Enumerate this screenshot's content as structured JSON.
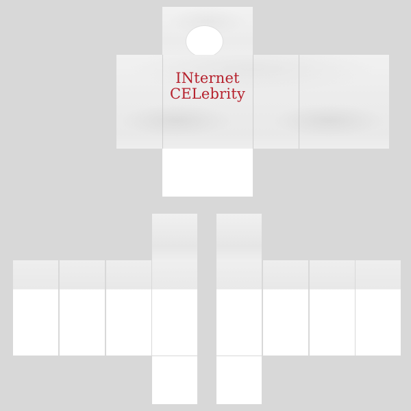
{
  "shirt_print": {
    "line1": "INternet",
    "line2": "CELebrity",
    "color": "#b51f2b"
  },
  "colors": {
    "background": "#d8d8d8",
    "panel": "#ffffff",
    "fabric": "#ececec"
  }
}
